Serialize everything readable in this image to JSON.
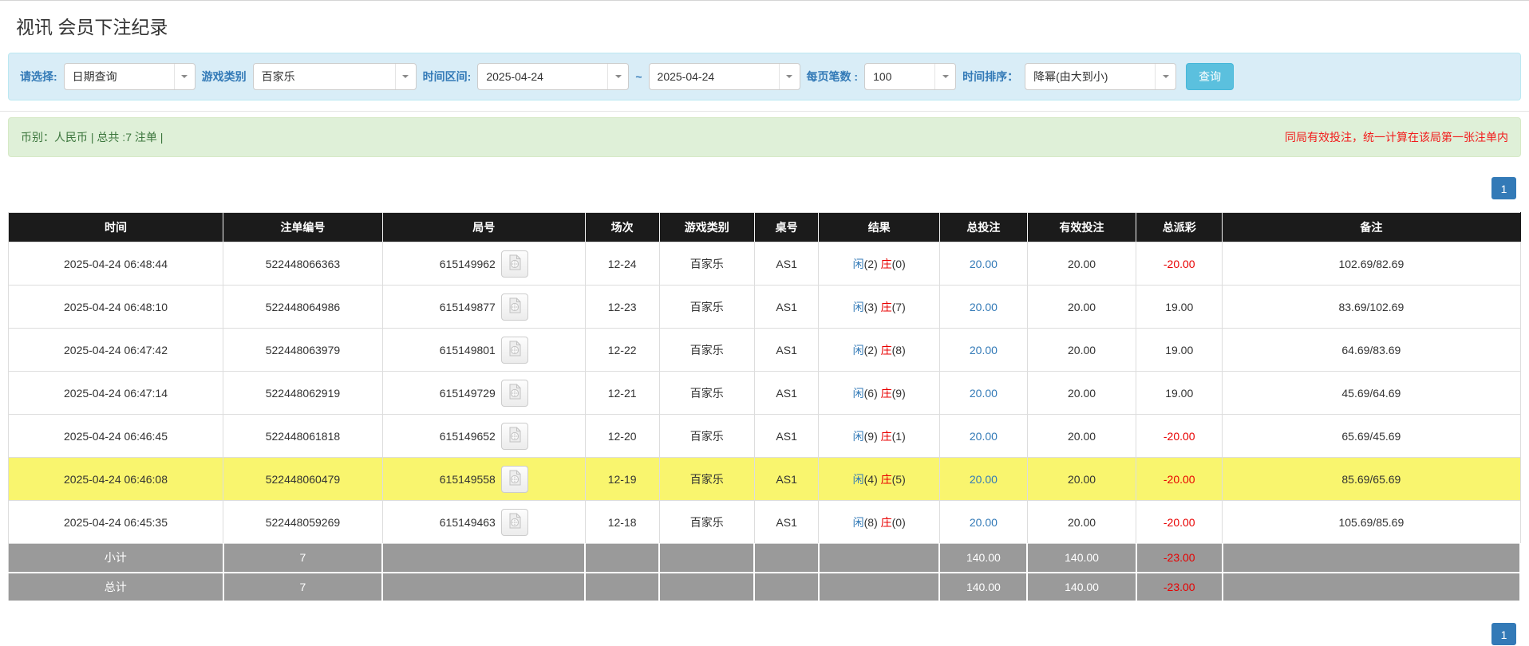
{
  "page_title": "视讯 会员下注纪录",
  "filters": {
    "select_label": "请选择:",
    "select_value": "日期查询",
    "game_type_label": "游戏类别",
    "game_type_value": "百家乐",
    "time_range_label": "时间区间:",
    "date_from": "2025-04-24",
    "tilde": "~",
    "date_to": "2025-04-24",
    "per_page_label": "每页笔数 :",
    "per_page_value": "100",
    "sort_label": "时间排序：",
    "sort_value": "降幂(由大到小)",
    "search_button": "查询"
  },
  "summary_bar": {
    "left_text": "币别：人民币 | 总共 :7 注单 |",
    "right_text": "同局有效投注，统一计算在该局第一张注单内"
  },
  "pagination": {
    "page": "1"
  },
  "icons": {
    "video": "video-file-icon",
    "dropdown": "chevron-down-icon"
  },
  "colors": {
    "link_blue": "#337ab7",
    "table_red": "#e80000",
    "notice_red": "#f21b1b",
    "highlight_yellow": "#f9f56e",
    "header_black": "#1b1b1b",
    "summary_gray": "#9a9a9a",
    "filter_bg": "#d9edf7",
    "info_bg": "#dff0d8",
    "info_text": "#3c763d",
    "search_button_bg": "#5bc0de"
  },
  "table": {
    "headers": [
      "时间",
      "注单编号",
      "局号",
      "场次",
      "游戏类别",
      "桌号",
      "结果",
      "总投注",
      "有效投注",
      "总派彩",
      "备注"
    ],
    "rows": [
      {
        "time": "2025-04-24 06:48:44",
        "bet_id": "522448066363",
        "round_id": "615149962",
        "session": "12-24",
        "game_type": "百家乐",
        "table_no": "AS1",
        "result": {
          "p_label": "闲",
          "p_val": "(2)",
          "b_label": "庄",
          "b_val": "(0)"
        },
        "total_bet": "20.00",
        "valid_bet": "20.00",
        "payout": "-20.00",
        "note": "102.69/82.69",
        "highlight": false
      },
      {
        "time": "2025-04-24 06:48:10",
        "bet_id": "522448064986",
        "round_id": "615149877",
        "session": "12-23",
        "game_type": "百家乐",
        "table_no": "AS1",
        "result": {
          "p_label": "闲",
          "p_val": "(3)",
          "b_label": "庄",
          "b_val": "(7)"
        },
        "total_bet": "20.00",
        "valid_bet": "20.00",
        "payout": "19.00",
        "note": "83.69/102.69",
        "highlight": false
      },
      {
        "time": "2025-04-24 06:47:42",
        "bet_id": "522448063979",
        "round_id": "615149801",
        "session": "12-22",
        "game_type": "百家乐",
        "table_no": "AS1",
        "result": {
          "p_label": "闲",
          "p_val": "(2)",
          "b_label": "庄",
          "b_val": "(8)"
        },
        "total_bet": "20.00",
        "valid_bet": "20.00",
        "payout": "19.00",
        "note": "64.69/83.69",
        "highlight": false
      },
      {
        "time": "2025-04-24 06:47:14",
        "bet_id": "522448062919",
        "round_id": "615149729",
        "session": "12-21",
        "game_type": "百家乐",
        "table_no": "AS1",
        "result": {
          "p_label": "闲",
          "p_val": "(6)",
          "b_label": "庄",
          "b_val": "(9)"
        },
        "total_bet": "20.00",
        "valid_bet": "20.00",
        "payout": "19.00",
        "note": "45.69/64.69",
        "highlight": false
      },
      {
        "time": "2025-04-24 06:46:45",
        "bet_id": "522448061818",
        "round_id": "615149652",
        "session": "12-20",
        "game_type": "百家乐",
        "table_no": "AS1",
        "result": {
          "p_label": "闲",
          "p_val": "(9)",
          "b_label": "庄",
          "b_val": "(1)"
        },
        "total_bet": "20.00",
        "valid_bet": "20.00",
        "payout": "-20.00",
        "note": "65.69/45.69",
        "highlight": false
      },
      {
        "time": "2025-04-24 06:46:08",
        "bet_id": "522448060479",
        "round_id": "615149558",
        "session": "12-19",
        "game_type": "百家乐",
        "table_no": "AS1",
        "result": {
          "p_label": "闲",
          "p_val": "(4)",
          "b_label": "庄",
          "b_val": "(5)"
        },
        "total_bet": "20.00",
        "valid_bet": "20.00",
        "payout": "-20.00",
        "note": "85.69/65.69",
        "highlight": true
      },
      {
        "time": "2025-04-24 06:45:35",
        "bet_id": "522448059269",
        "round_id": "615149463",
        "session": "12-18",
        "game_type": "百家乐",
        "table_no": "AS1",
        "result": {
          "p_label": "闲",
          "p_val": "(8)",
          "b_label": "庄",
          "b_val": "(0)"
        },
        "total_bet": "20.00",
        "valid_bet": "20.00",
        "payout": "-20.00",
        "note": "105.69/85.69",
        "highlight": false
      }
    ],
    "subtotal": {
      "label": "小计",
      "count": "7",
      "total_bet": "140.00",
      "valid_bet": "140.00",
      "payout": "-23.00"
    },
    "total": {
      "label": "总计",
      "count": "7",
      "total_bet": "140.00",
      "valid_bet": "140.00",
      "payout": "-23.00"
    }
  }
}
